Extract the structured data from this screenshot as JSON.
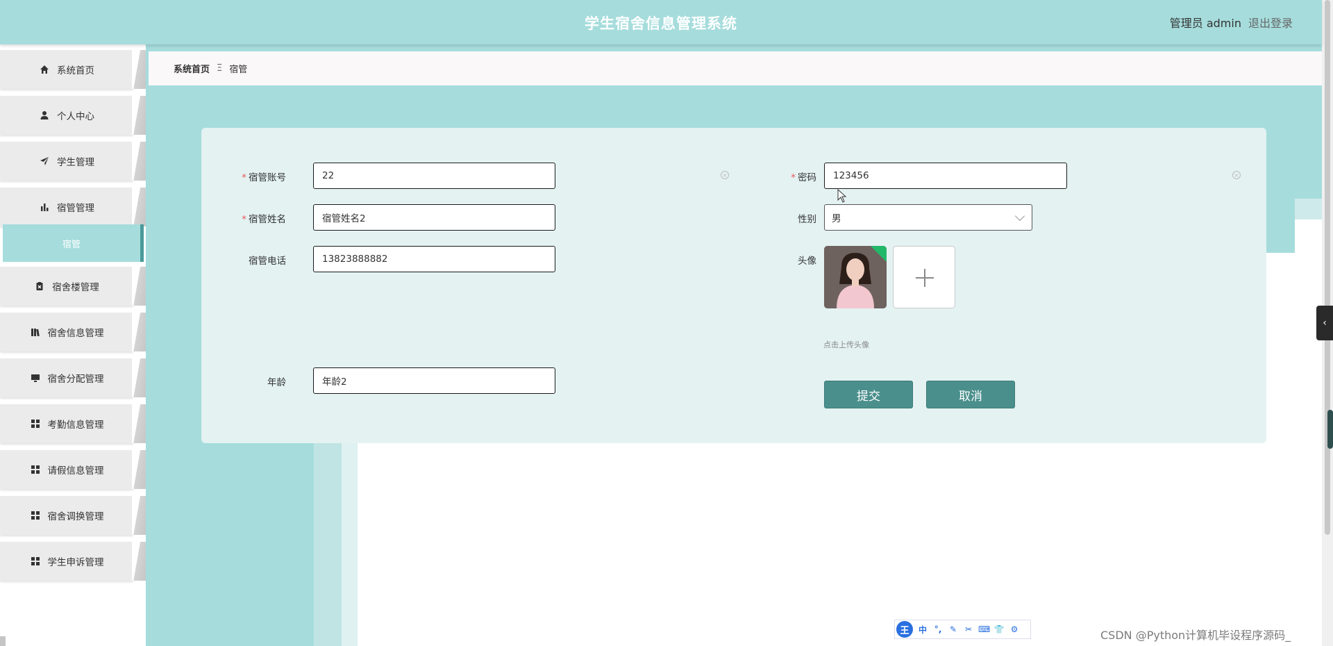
{
  "header": {
    "app_title": "学生宿舍信息管理系统",
    "user_label": "管理员 admin",
    "logout_label": "退出登录"
  },
  "sidebar": {
    "items": [
      {
        "label": "系统首页",
        "icon": "home-icon"
      },
      {
        "label": "个人中心",
        "icon": "user-icon"
      },
      {
        "label": "学生管理",
        "icon": "paper-plane-icon"
      },
      {
        "label": "宿管管理",
        "icon": "bar-chart-icon"
      },
      {
        "label": "宿舍楼管理",
        "icon": "clipboard-icon"
      },
      {
        "label": "宿舍信息管理",
        "icon": "books-icon"
      },
      {
        "label": "宿舍分配管理",
        "icon": "monitor-icon"
      },
      {
        "label": "考勤信息管理",
        "icon": "grid-icon"
      },
      {
        "label": "请假信息管理",
        "icon": "grid-icon"
      },
      {
        "label": "宿舍调换管理",
        "icon": "grid-icon"
      },
      {
        "label": "学生申诉管理",
        "icon": "grid-icon"
      }
    ],
    "active_submenu": "宿管"
  },
  "breadcrumb": {
    "home": "系统首页",
    "separator": "Ξ",
    "current": "宿管"
  },
  "form": {
    "account": {
      "label": "宿管账号",
      "value": "22",
      "required": true
    },
    "password": {
      "label": "密码",
      "value": "123456",
      "required": true
    },
    "name": {
      "label": "宿管姓名",
      "value": "宿管姓名2",
      "required": true
    },
    "gender": {
      "label": "性别",
      "value": "男"
    },
    "phone": {
      "label": "宿管电话",
      "value": "13823888882"
    },
    "avatar": {
      "label": "头像",
      "hint": "点击上传头像"
    },
    "age": {
      "label": "年龄",
      "value": "年龄2"
    },
    "submit_label": "提交",
    "cancel_label": "取消"
  },
  "ime_toolbar": {
    "logo": "王",
    "items": [
      "中",
      "°,",
      "✎",
      "✂",
      "⌨",
      "👕",
      "⚙"
    ]
  },
  "watermark": "CSDN @Python计算机毕设程序源码_",
  "colors": {
    "header_bg": "#a6dcdc",
    "main_bg": "#a6dcdc",
    "card_bg": "#e4f2f2",
    "button_bg": "#4a8f8c",
    "active_menu_bg": "#a6dcdc",
    "required_mark": "#e85a5a"
  }
}
